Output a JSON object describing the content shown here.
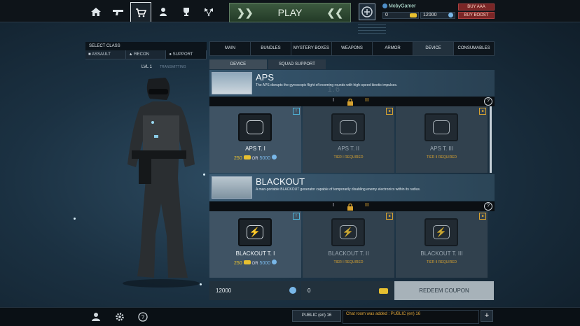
{
  "nav": {
    "icons": [
      "home-icon",
      "weapon-icon",
      "shop-icon",
      "soldier-icon",
      "trophy-icon",
      "flags-icon"
    ],
    "active": "shop-icon"
  },
  "play": {
    "label": "PLAY"
  },
  "user": {
    "name": "MobyGamer",
    "gold": "0",
    "credits": "12000",
    "buy_aaa": "BUY AAA",
    "buy_boost": "BUY BOOST"
  },
  "class_select": {
    "header": "SELECT CLASS",
    "options": [
      "ASSAULT",
      "RECON",
      "SUPPORT"
    ],
    "selected": "SUPPORT",
    "level": "LVL 1",
    "progress_label": "TRANSMITTING"
  },
  "tabs": {
    "items": [
      "MAIN",
      "BUNDLES",
      "MYSTERY BOXES",
      "WEAPONS",
      "ARMOR",
      "DEVICE",
      "CONSUMABLES"
    ],
    "selected": "DEVICE"
  },
  "subtabs": {
    "items": [
      "DEVICE",
      "SQUAD SUPPORT"
    ],
    "selected": "DEVICE"
  },
  "categories": [
    {
      "title": "APS",
      "description": "The APS disrupts the gyroscopic flight of incoming rounds with high-speed kinetic impulses.",
      "watermark": "1.6",
      "tiers": [
        "I",
        "II",
        "III"
      ],
      "items": [
        {
          "name": "APS T. I",
          "gold": "250",
          "or": "OR",
          "credits": "5000",
          "locked": false
        },
        {
          "name": "APS T. II",
          "requirement": "TIER I REQUIRED",
          "locked": true
        },
        {
          "name": "APS T. III",
          "requirement": "TIER II REQUIRED",
          "locked": true
        }
      ]
    },
    {
      "title": "BLACKOUT",
      "description": "A man-portable BLACKOUT generator capable of temporarily disabling enemy electronics within its radius.",
      "tiers": [
        "I",
        "II",
        "III"
      ],
      "items": [
        {
          "name": "BLACKOUT T. I",
          "gold": "250",
          "or": "OR",
          "credits": "5000",
          "locked": false
        },
        {
          "name": "BLACKOUT T. II",
          "requirement": "TIER I REQUIRED",
          "locked": true
        },
        {
          "name": "BLACKOUT T. III",
          "requirement": "TIER II REQUIRED",
          "locked": true
        }
      ]
    }
  ],
  "bottom": {
    "credits": "12000",
    "gold": "0",
    "redeem": "REDEEM COUPON"
  },
  "chat": {
    "room": "PUBLIC (en) 16",
    "log": "Chat room was added : PUBLIC (en) 16",
    "plus": "+"
  },
  "colors": {
    "gold": "#e7c030",
    "credits_blue": "#79b7e8",
    "play_green": "#3c5a3f",
    "buy_red": "#7a2626",
    "locked_text": "#d7a230"
  }
}
